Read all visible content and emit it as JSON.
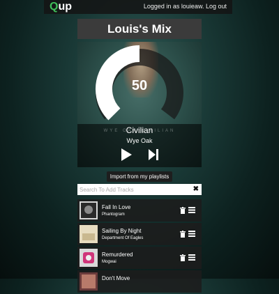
{
  "header": {
    "logo_q": "Q",
    "logo_rest": "up",
    "logged_in_text": "Logged in as louieaw.",
    "logout_label": "Log out"
  },
  "playlist": {
    "title": "Louis's Mix"
  },
  "player": {
    "volume": "50",
    "volume_fraction": 0.5,
    "ghost_text": "WYE OAK   CIVILIAN",
    "track": "Civilian",
    "artist": "Wye Oak"
  },
  "import_label": "Import from my playlists",
  "search": {
    "placeholder": "Search To Add Tracks",
    "clear_icon": "close-icon",
    "value": ""
  },
  "tracks": [
    {
      "title": "Fall In Love",
      "artist": "Phantogram"
    },
    {
      "title": "Sailing By Night",
      "artist": "Department Of Eagles"
    },
    {
      "title": "Remurdered",
      "artist": "Mogwai"
    },
    {
      "title": "Don't Move",
      "artist": ""
    }
  ],
  "colors": {
    "accent": "#3fbf5a",
    "dial": "#ffffff",
    "dial_track": "#1a1a1a"
  }
}
